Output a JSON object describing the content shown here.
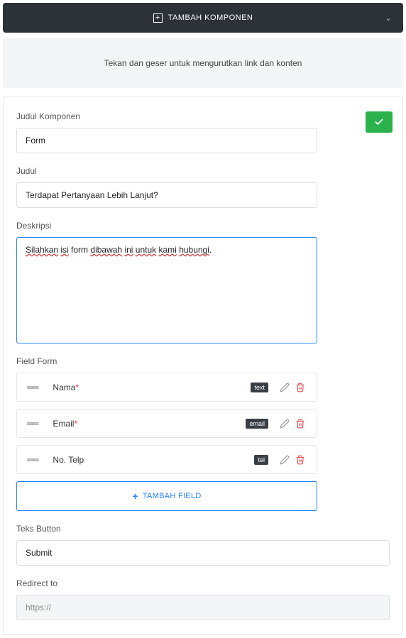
{
  "topbar": {
    "label": "TAMBAH KOMPONEN"
  },
  "hint": "Tekan dan geser untuk mengurutkan link dan konten",
  "labels": {
    "judul_komponen": "Judul Komponen",
    "judul": "Judul",
    "deskripsi": "Deskripsi",
    "field_form": "Field Form",
    "teks_button": "Teks Button",
    "redirect_to": "Redirect to"
  },
  "values": {
    "judul_komponen": "Form",
    "judul": "Terdapat Pertanyaan Lebih Lanjut?",
    "deskripsi_parts": {
      "p1": "Silahkan",
      "p2": " ",
      "p3": "isi",
      "p4": " form ",
      "p5": "dibawah",
      "p6": " ",
      "p7": "ini",
      "p8": " ",
      "p9": "untuk",
      "p10": " ",
      "p11": "kami",
      "p12": " ",
      "p13": "hubungi",
      "p14": "."
    },
    "teks_button": "Submit",
    "redirect_to": "https://"
  },
  "fields": [
    {
      "name": "Nama",
      "required": true,
      "type": "text"
    },
    {
      "name": "Email",
      "required": true,
      "type": "email"
    },
    {
      "name": "No. Telp",
      "required": false,
      "type": "tel"
    }
  ],
  "add_field": "TAMBAH FIELD"
}
